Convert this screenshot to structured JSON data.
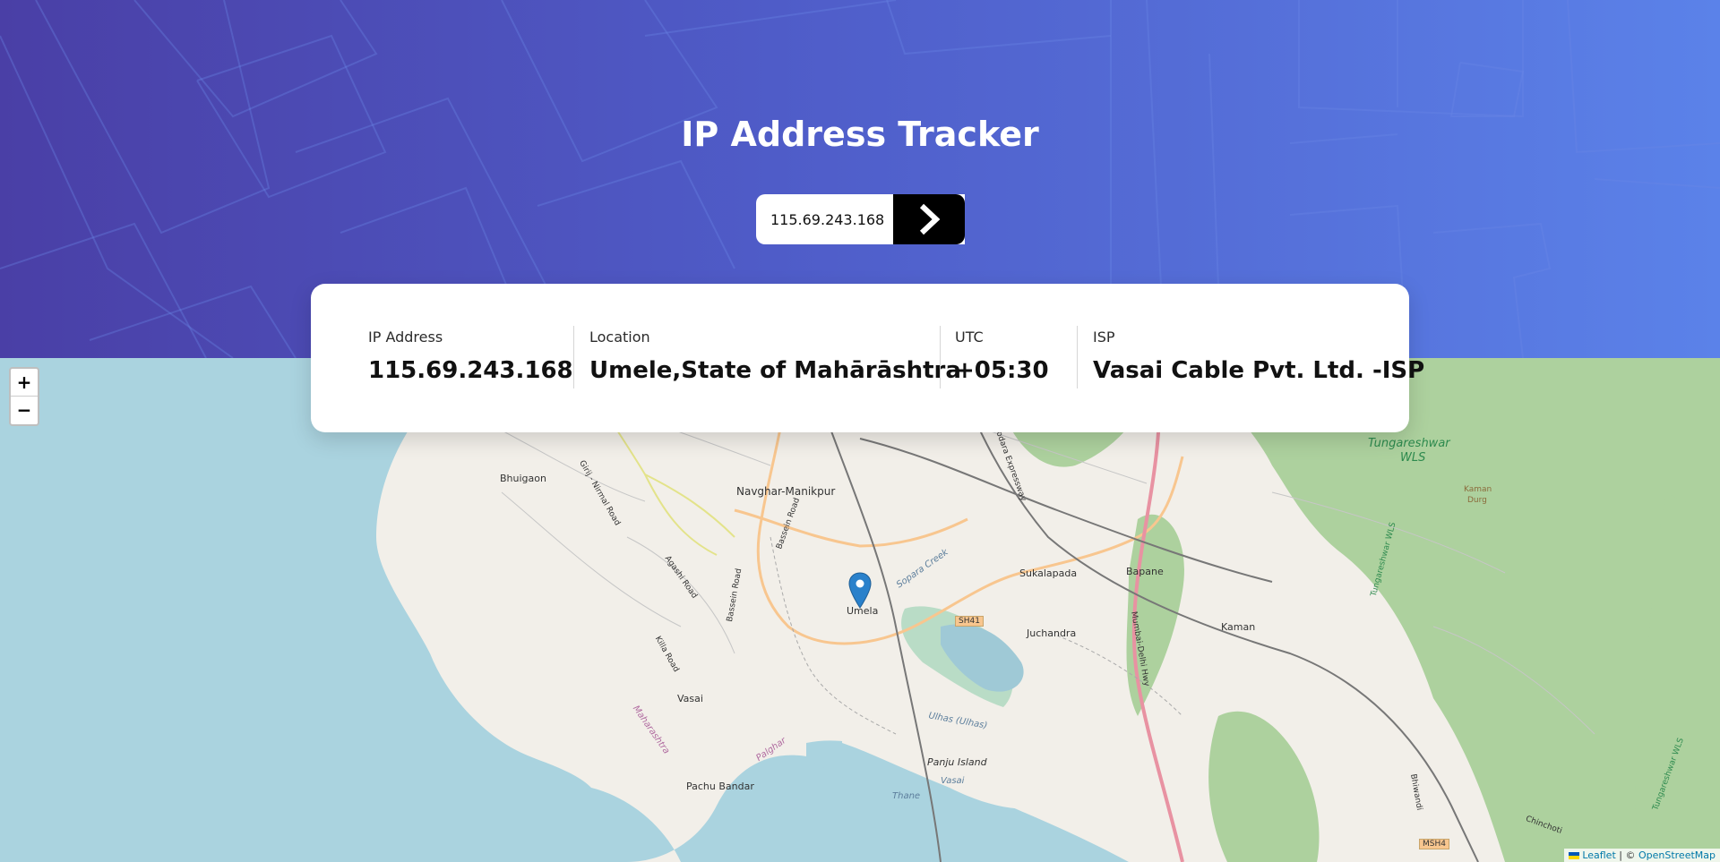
{
  "header": {
    "title": "IP Address Tracker",
    "search_value": "115.69.243.168",
    "search_button_icon": "chevron-right-icon"
  },
  "info": {
    "ip_label": "IP Address",
    "ip_value": "115.69.243.168",
    "location_label": "Location",
    "location_value": "Umele,State of Mahārāshtra",
    "utc_label": "UTC",
    "utc_value": "+05:30",
    "isp_label": "ISP",
    "isp_value": "Vasai Cable Pvt. Ltd. -ISP"
  },
  "map": {
    "zoom_in": "+",
    "zoom_out": "−",
    "attribution_leaflet": "Leaflet",
    "attribution_sep": " | © ",
    "attribution_osm": "OpenStreetMap",
    "labels": {
      "bhuigaon": "Bhuigaon",
      "navghar": "Navghar-Manikpur",
      "umela": "Umela",
      "sukalapada": "Sukalapada",
      "bapane": "Bapane",
      "juchandra": "Juchandra",
      "kaman": "Kaman",
      "vasai": "Vasai",
      "panju": "Panju Island",
      "pachu": "Pachu Bandar",
      "tungareshwar": "Tungareshwar",
      "wls": "WLS",
      "kaman_durg": "Kaman",
      "durg": "Durg",
      "sh41": "SH41",
      "msh4": "MSH4",
      "maharashtra": "Maharashtra",
      "palghar": "Palghar",
      "thane": "Thane",
      "ulhas": "Ulhas (Ulhas)",
      "vasai_creek": "Vasai",
      "sopara": "Sopara Creek",
      "bassein_road": "Bassein Road",
      "killa_road": "Killa Road",
      "agashi_road": "Agashi Road",
      "chinchoti": "Chinchoti",
      "tungareshwar_wls": "Tungareshwar WLS",
      "vasai_road": "Vasai",
      "girij": "Girij - Nirmal Road",
      "mve": "Mumbai Vadodara Expressway",
      "nh48": "Mumbai-Delhi Hwy",
      "bhiwandi": "Bhiwandi"
    }
  },
  "colors": {
    "header_start": "#4a3fa6",
    "header_end": "#5b82e9",
    "sea": "#aad3df",
    "land": "#f2efe9",
    "forest": "#add19e",
    "marker": "#2a81cb"
  }
}
